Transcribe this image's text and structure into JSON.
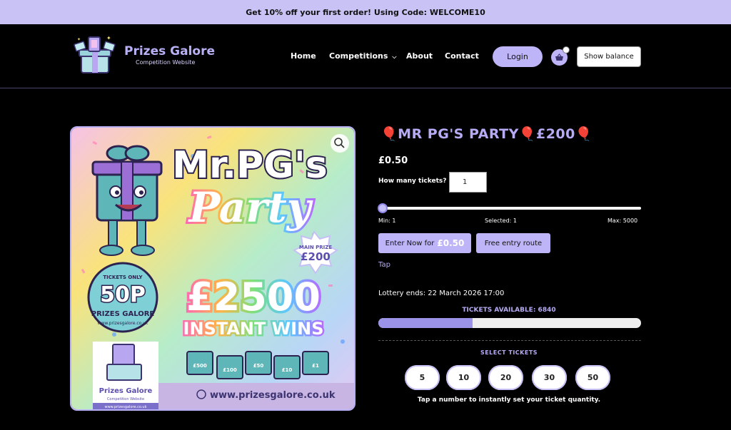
{
  "promo": {
    "text": "Get 10% off your first order! Using Code: WELCOME10"
  },
  "header": {
    "brand_name": "Prizes Galore",
    "brand_sub": "Competition Website",
    "nav": {
      "home": "Home",
      "competitions": "Competitions",
      "about": "About",
      "contact": "Contact"
    },
    "login": "Login",
    "show_balance": "Show balance"
  },
  "hero": {
    "title_line1": "Mr.PG's",
    "title_line2": "Party",
    "main_prize_label": "MAIN PRIZE",
    "main_prize_value": "£200",
    "amount": "£2500",
    "amount_sub": "INSTANT WINS",
    "tickets_only": "TICKETS ONLY",
    "ticket_price": "50P",
    "badge_brand": "PRIZES GALORE",
    "badge_url": "www.prizesgalore.co.uk",
    "logo_name": "Prizes Galore",
    "logo_sub": "Competition Website",
    "logo_url": "www.prizesgalore.co.uk",
    "footer_url": "www.prizesgalore.co.uk",
    "gift_labels": [
      "£500",
      "£100",
      "£50",
      "£10",
      "£1"
    ]
  },
  "product": {
    "title": "🎈MR PG'S PARTY🎈£200🎈",
    "price": "£0.50",
    "qty_label": "How many tickets?",
    "qty_value": "1",
    "slider": {
      "min": "Min: 1",
      "selected": "Selected: 1",
      "max": "Max: 5000",
      "fraction": 0.0
    },
    "enter_label": "Enter Now for",
    "enter_price": "£0.50",
    "free_entry": "Free entry route",
    "tap": "Tap",
    "lottery_ends": "Lottery ends: 22 March 2026 17:00",
    "tickets_available": "TICKETS AVAILABLE: 6840",
    "sold_fraction": 0.36,
    "select_title": "SELECT TICKETS",
    "presets": [
      "5",
      "10",
      "20",
      "30",
      "50"
    ],
    "select_hint": "Tap a number to instantly set your ticket quantity."
  },
  "colors": {
    "accent": "#b6abf4",
    "promo_bg": "#c9c3f5",
    "button": "#bdb5f7"
  }
}
